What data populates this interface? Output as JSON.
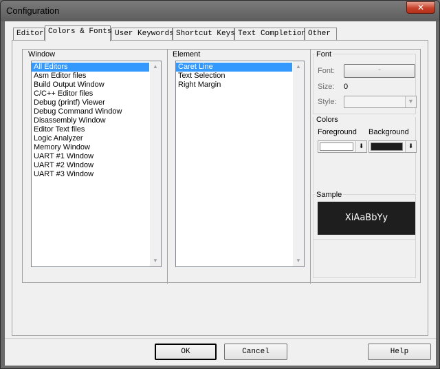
{
  "window": {
    "title": "Configuration",
    "close_glyph": "✕"
  },
  "tabs": [
    {
      "label": "Editor"
    },
    {
      "label": "Colors & Fonts",
      "active": true
    },
    {
      "label": "User Keywords"
    },
    {
      "label": "Shortcut Keys"
    },
    {
      "label": "Text Completion"
    },
    {
      "label": "Other"
    }
  ],
  "window_group": {
    "label": "Window",
    "items": [
      "All Editors",
      "Asm Editor files",
      "Build Output Window",
      "C/C++ Editor files",
      "Debug (printf) Viewer",
      "Debug Command Window",
      "Disassembly Window",
      "Editor Text files",
      "Logic Analyzer",
      "Memory Window",
      "UART #1 Window",
      "UART #2 Window",
      "UART #3 Window"
    ],
    "selected": "All Editors"
  },
  "element_group": {
    "label": "Element",
    "items": [
      "Caret Line",
      "Text Selection",
      "Right Margin"
    ],
    "selected": "Caret Line"
  },
  "font_group": {
    "label": "Font",
    "font_label": "Font:",
    "font_button": "-",
    "size_label": "Size:",
    "size_value": "0",
    "style_label": "Style:",
    "style_value": ""
  },
  "colors_group": {
    "label": "Colors",
    "foreground_label": "Foreground",
    "background_label": "Background",
    "foreground_color": "#ffffff",
    "background_color": "#1e1e1e",
    "dropdown_glyph": "⬇"
  },
  "sample_group": {
    "label": "Sample",
    "text": "XiAaBbYy"
  },
  "buttons": {
    "ok": "OK",
    "cancel": "Cancel",
    "help": "Help"
  }
}
